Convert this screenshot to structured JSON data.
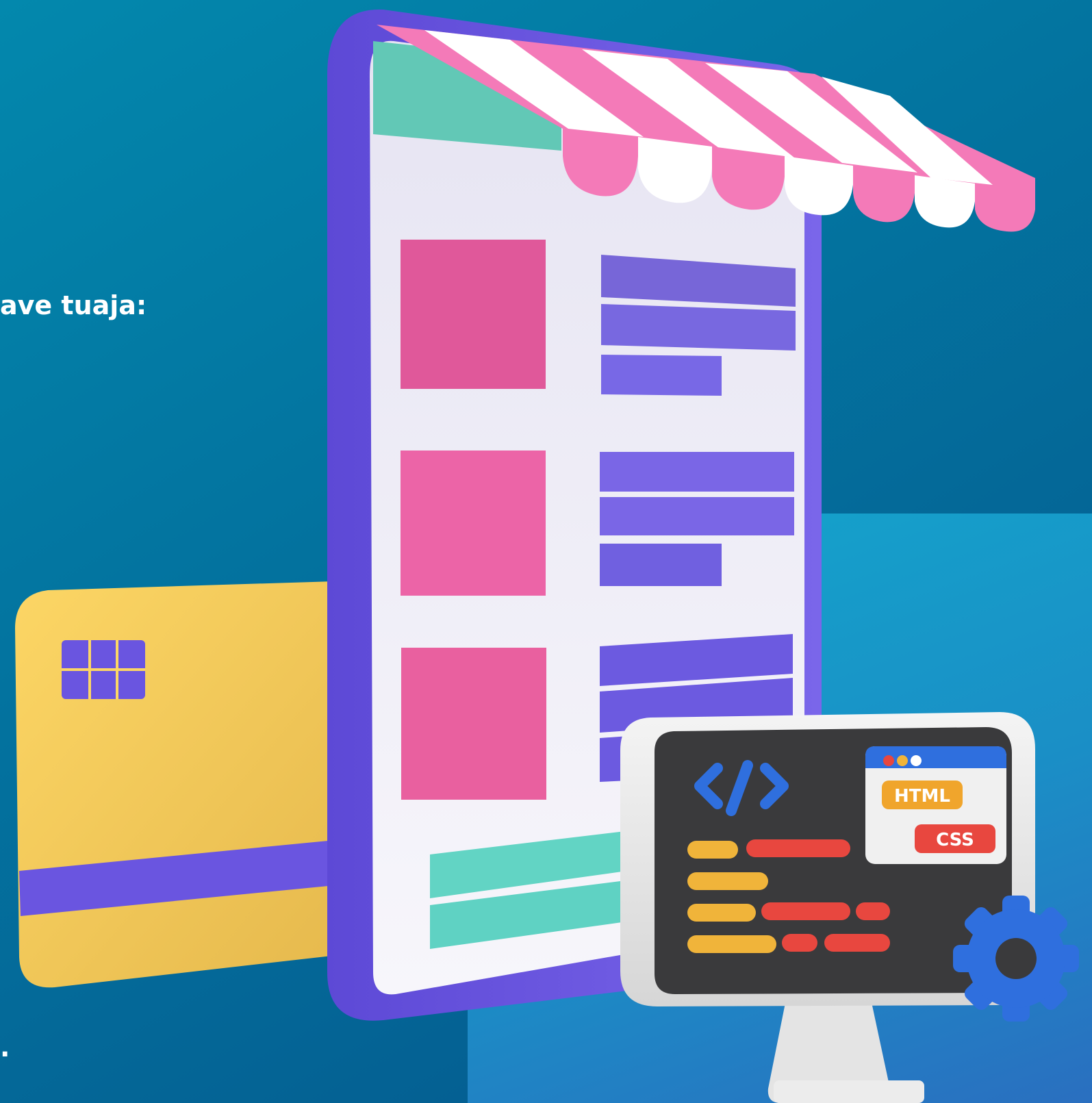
{
  "text": {
    "heading": "ave tuaja:",
    "trailing_mark": "."
  },
  "illustration": {
    "monitor_badges": [
      "HTML",
      "CSS"
    ],
    "icons": [
      "storefront-phone-icon",
      "credit-card-icon",
      "code-monitor-icon",
      "gear-icon"
    ]
  },
  "colors": {
    "background": "#03739f",
    "panel": "#1a8fc6",
    "phone_frame": "#6a55e0",
    "awning_pink": "#f47ab8",
    "tile_pink": "#e9609f",
    "bar_purple": "#7766e4",
    "bar_teal": "#62d4c4",
    "card_yellow": "#f6cd5a",
    "gear_blue": "#2f6fde",
    "html_orange": "#f0a52c",
    "css_red": "#e8473f"
  }
}
